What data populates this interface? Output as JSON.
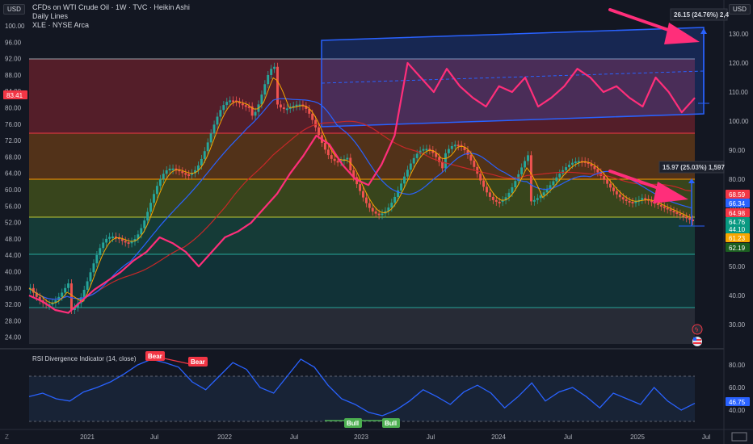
{
  "header": {
    "currency": "USD",
    "title": "CFDs on WTI Crude Oil · 1W · TVC · Heikin Ashi",
    "line2": "Daily Lines",
    "line3": "XLE · NYSE Arca"
  },
  "left_axis": {
    "ticks": [
      "100.00",
      "96.00",
      "92.00",
      "88.00",
      "84.00",
      "80.00",
      "76.00",
      "72.00",
      "68.00",
      "64.00",
      "60.00",
      "56.00",
      "52.00",
      "48.00",
      "44.00",
      "40.00",
      "36.00",
      "32.00",
      "28.00",
      "24.00"
    ],
    "current": "83.41"
  },
  "right_axis": {
    "currency": "USD",
    "ticks": [
      "130.00",
      "120.00",
      "110.00",
      "100.00",
      "90.00",
      "80.00",
      "70.00",
      "60.00",
      "50.00",
      "40.00",
      "30.00"
    ],
    "rsi_ticks": [
      "80.00",
      "60.00",
      "40.00"
    ],
    "badges": [
      {
        "text": "68.59",
        "color": "#f23645"
      },
      {
        "text": "66.34",
        "color": "#2962ff"
      },
      {
        "text": "64.98",
        "color": "#f23645"
      },
      {
        "text": "64.76",
        "color": "#089981"
      },
      {
        "text": "44.10",
        "color": "#089981"
      },
      {
        "text": "61.23",
        "color": "#f7a600"
      },
      {
        "text": "62.19",
        "color": "#1b5e20"
      }
    ],
    "rsi_badge": "46.75"
  },
  "measure": {
    "top_label": "26.15 (24.76%) 2,4",
    "mid_label": "15.97 (25.03%) 1,597"
  },
  "rsi": {
    "title": "RSI Divergence Indicator (14, close)",
    "bear_labels": [
      "Bear",
      "Bear"
    ],
    "bull_labels": [
      "Bull",
      "Bull"
    ]
  },
  "x_axis": {
    "ticks": [
      "2021",
      "Jul",
      "2022",
      "Jul",
      "2023",
      "Jul",
      "2024",
      "Jul",
      "2025",
      "Jul"
    ]
  },
  "colors": {
    "background": "#131722",
    "candle_up": "#26a69a",
    "candle_down": "#ef5350",
    "xle_line": "#ff2e7a",
    "channel": "#2962ff",
    "rsi_line": "#2962ff"
  },
  "icons": [
    "goto-realtime-icon",
    "flag-usa-icon",
    "tv-logo-icon",
    "z-icon"
  ],
  "chart_data": {
    "type": "line",
    "series": [
      {
        "name": "XLE · NYSE Arca",
        "values": [
          40,
          38,
          35,
          34,
          38,
          42,
          45,
          48,
          52,
          55,
          60,
          58,
          55,
          50,
          55,
          60,
          62,
          65,
          70,
          75,
          82,
          88,
          95,
          92,
          85,
          80,
          78,
          85,
          95,
          120,
          115,
          110,
          118,
          112,
          108,
          105,
          112,
          110,
          115,
          105,
          108,
          112,
          118,
          115,
          110,
          112,
          108,
          105,
          115,
          110,
          103,
          108
        ]
      },
      {
        "name": "RSI Divergence Indicator (14, close)",
        "values": [
          52,
          55,
          50,
          48,
          56,
          60,
          65,
          72,
          80,
          85,
          82,
          78,
          65,
          58,
          70,
          82,
          76,
          60,
          55,
          70,
          85,
          78,
          62,
          50,
          45,
          38,
          35,
          40,
          48,
          58,
          52,
          45,
          56,
          62,
          55,
          42,
          52,
          64,
          48,
          56,
          60,
          52,
          42,
          55,
          50,
          45,
          60,
          48,
          40,
          46
        ]
      }
    ]
  }
}
